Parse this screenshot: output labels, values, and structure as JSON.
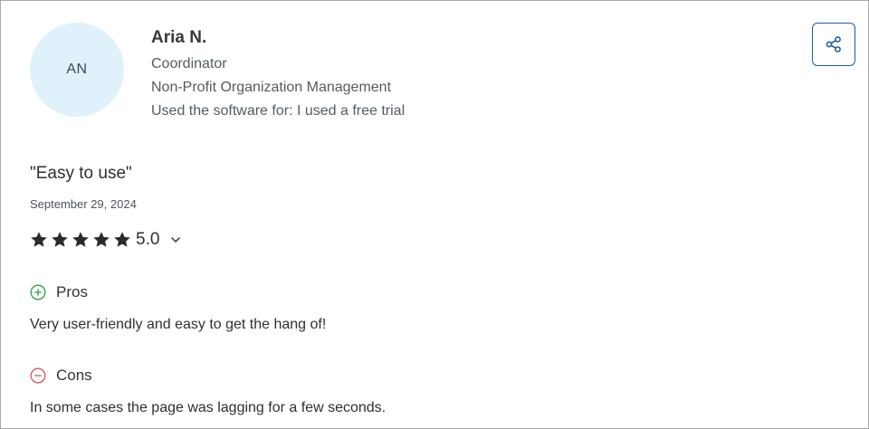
{
  "reviewer": {
    "initials": "AN",
    "name": "Aria N.",
    "role": "Coordinator",
    "industry": "Non-Profit Organization Management",
    "usage": "Used the software for: I used a free trial"
  },
  "share": {
    "icon": "share-icon"
  },
  "review": {
    "title": "\"Easy to use\"",
    "date": "September 29, 2024",
    "rating": {
      "value": "5.0",
      "stars": 5,
      "max": 5
    },
    "pros": {
      "label": "Pros",
      "text": "Very user-friendly and easy to get the hang of!"
    },
    "cons": {
      "label": "Cons",
      "text": "In some cases the page was lagging for a few seconds."
    }
  },
  "colors": {
    "avatar_bg": "#dff2fb",
    "share_border": "#1f5f9e",
    "star": "#2b2b2b",
    "pros_icon": "#2e9e45",
    "cons_icon": "#d9534f",
    "border": "#a9a9a9"
  }
}
